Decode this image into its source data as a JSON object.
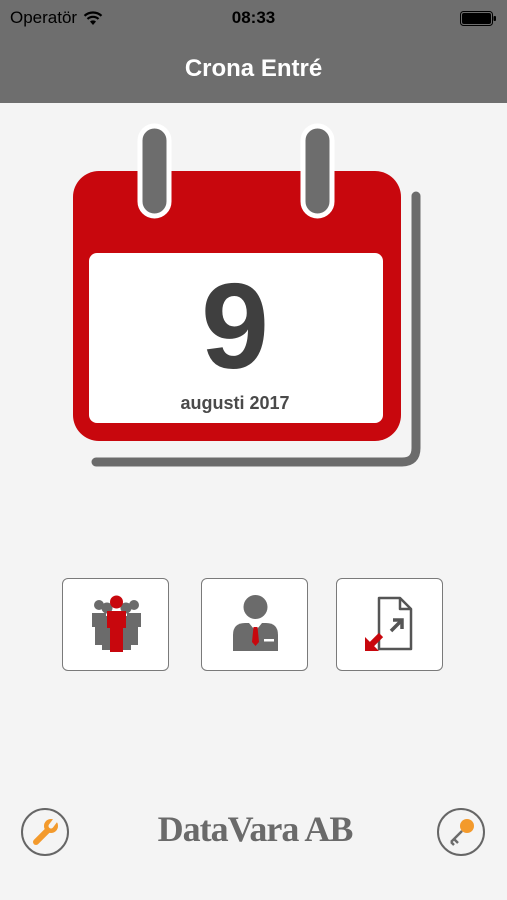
{
  "status_bar": {
    "carrier": "Operatör",
    "time": "08:33",
    "wifi_icon": "wifi-icon",
    "battery_icon": "battery-icon"
  },
  "nav": {
    "title": "Crona Entré"
  },
  "calendar": {
    "day": "9",
    "month_year": "augusti 2017",
    "accent_color": "#c8070d",
    "icon": "calendar-icon"
  },
  "actions": [
    {
      "icon": "group-icon"
    },
    {
      "icon": "person-icon"
    },
    {
      "icon": "import-document-icon"
    }
  ],
  "footer": {
    "brand": "DataVara AB",
    "settings_icon": "wrench-icon",
    "key_icon": "key-icon",
    "accent_color": "#f39a2c"
  }
}
